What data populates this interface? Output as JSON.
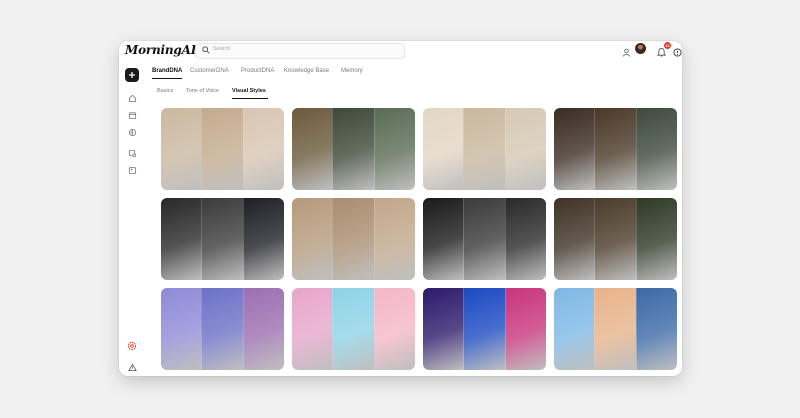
{
  "app": {
    "name": "MorningAI"
  },
  "search": {
    "placeholder": "Search"
  },
  "header": {
    "notification_count": "12"
  },
  "tabs": [
    {
      "label": "BrandDNA",
      "active": true
    },
    {
      "label": "CustomerDNA",
      "active": false
    },
    {
      "label": "ProductDNA",
      "active": false
    },
    {
      "label": "Knowledge Base",
      "active": false
    },
    {
      "label": "Memory",
      "active": false
    }
  ],
  "subtabs": [
    {
      "label": "Basics",
      "active": false
    },
    {
      "label": "Tone of Voice",
      "active": false
    },
    {
      "label": "Visual Styles",
      "active": true
    }
  ],
  "sidebar": {
    "icons": [
      "plus-icon",
      "home-icon",
      "calendar-icon",
      "brain-icon",
      "image-search-icon",
      "image-icon",
      "settings-alert-icon",
      "warning-icon",
      "gear-icon"
    ]
  },
  "colors": {
    "accent": "#e3372b",
    "dark": "#1c1c1c"
  },
  "style_tiles": [
    {
      "name": "warm-minimal-interior",
      "panels": [
        "#cbb8a0",
        "#c4ab8e",
        "#d8c6b2"
      ]
    },
    {
      "name": "botanical-illustration",
      "panels": [
        "#6b5a3c",
        "#3e4a38",
        "#5b6b55"
      ]
    },
    {
      "name": "soft-beige-still-life",
      "panels": [
        "#e3d6c4",
        "#c9b89e",
        "#d6c9b4"
      ]
    },
    {
      "name": "moody-cinematic",
      "panels": [
        "#3b2c22",
        "#4a3928",
        "#3d4a3c"
      ]
    },
    {
      "name": "dark-fantasy",
      "panels": [
        "#282828",
        "#3b3b3b",
        "#1f2026"
      ]
    },
    {
      "name": "earthy-minimal",
      "panels": [
        "#b59a7b",
        "#a98e70",
        "#c0a78a"
      ]
    },
    {
      "name": "noir-black-white",
      "panels": [
        "#1a1a1a",
        "#3a3a3a",
        "#2a2a2a"
      ]
    },
    {
      "name": "vintage-ornate",
      "panels": [
        "#3e3225",
        "#4b3b2a",
        "#2e3a27"
      ]
    },
    {
      "name": "dreamy-neon-fantasy",
      "panels": [
        "#8f8ad8",
        "#6d71c7",
        "#9b6fb0"
      ]
    },
    {
      "name": "pastel-pop",
      "panels": [
        "#e8a6cb",
        "#8fd3e6",
        "#f4b7c7"
      ]
    },
    {
      "name": "cyberpunk-neon",
      "panels": [
        "#2d1a6b",
        "#1b4ac2",
        "#c8357c"
      ]
    },
    {
      "name": "pixel-art",
      "panels": [
        "#7fb8e6",
        "#e8b38a",
        "#3c6aa6"
      ]
    }
  ]
}
